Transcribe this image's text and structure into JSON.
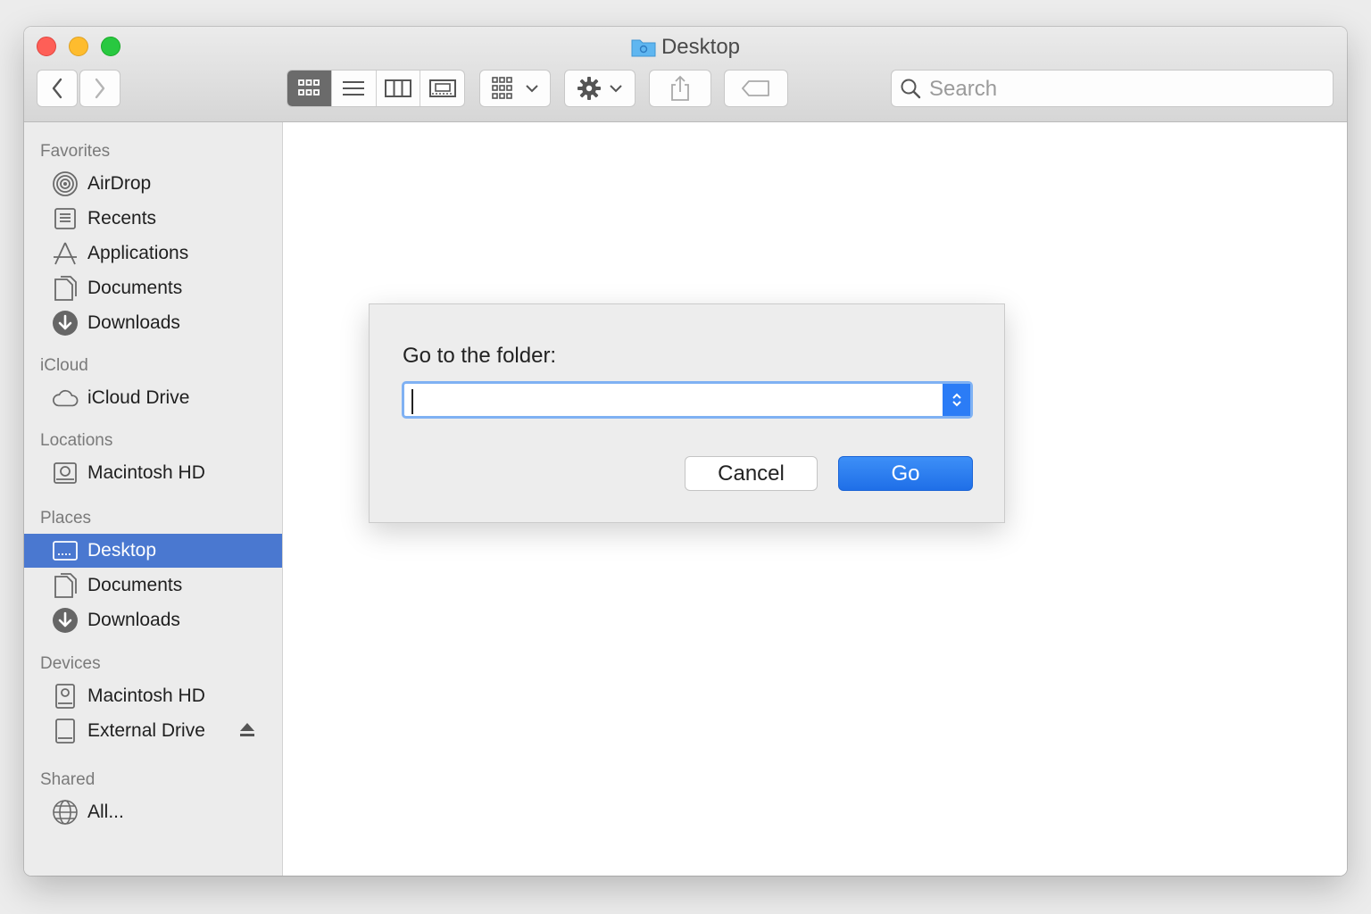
{
  "window": {
    "title": "Desktop",
    "search_placeholder": "Search"
  },
  "toolbar": {
    "view_modes": [
      "icon-view",
      "list-view",
      "column-view",
      "gallery-view"
    ],
    "active_view": "icon-view"
  },
  "sidebar": {
    "favorites": {
      "heading": "Favorites",
      "items": [
        "AirDrop",
        "Recents",
        "Applications",
        "Documents",
        "Downloads"
      ]
    },
    "icloud": {
      "heading": "iCloud",
      "items": [
        "iCloud Drive"
      ]
    },
    "locations": {
      "heading": "Locations",
      "items": [
        "Macintosh HD"
      ]
    },
    "places": {
      "heading": "Places",
      "items": [
        "Desktop",
        "Documents",
        "Downloads"
      ],
      "selected": "Desktop"
    },
    "devices": {
      "heading": "Devices",
      "items": [
        "Macintosh HD",
        "External Drive"
      ]
    },
    "shared": {
      "heading": "Shared",
      "items": [
        "All..."
      ]
    }
  },
  "dialog": {
    "label": "Go to the folder:",
    "path_value": "",
    "cancel_label": "Cancel",
    "go_label": "Go"
  },
  "colors": {
    "selection": "#4a78d0",
    "accent": "#2b7cf6"
  }
}
